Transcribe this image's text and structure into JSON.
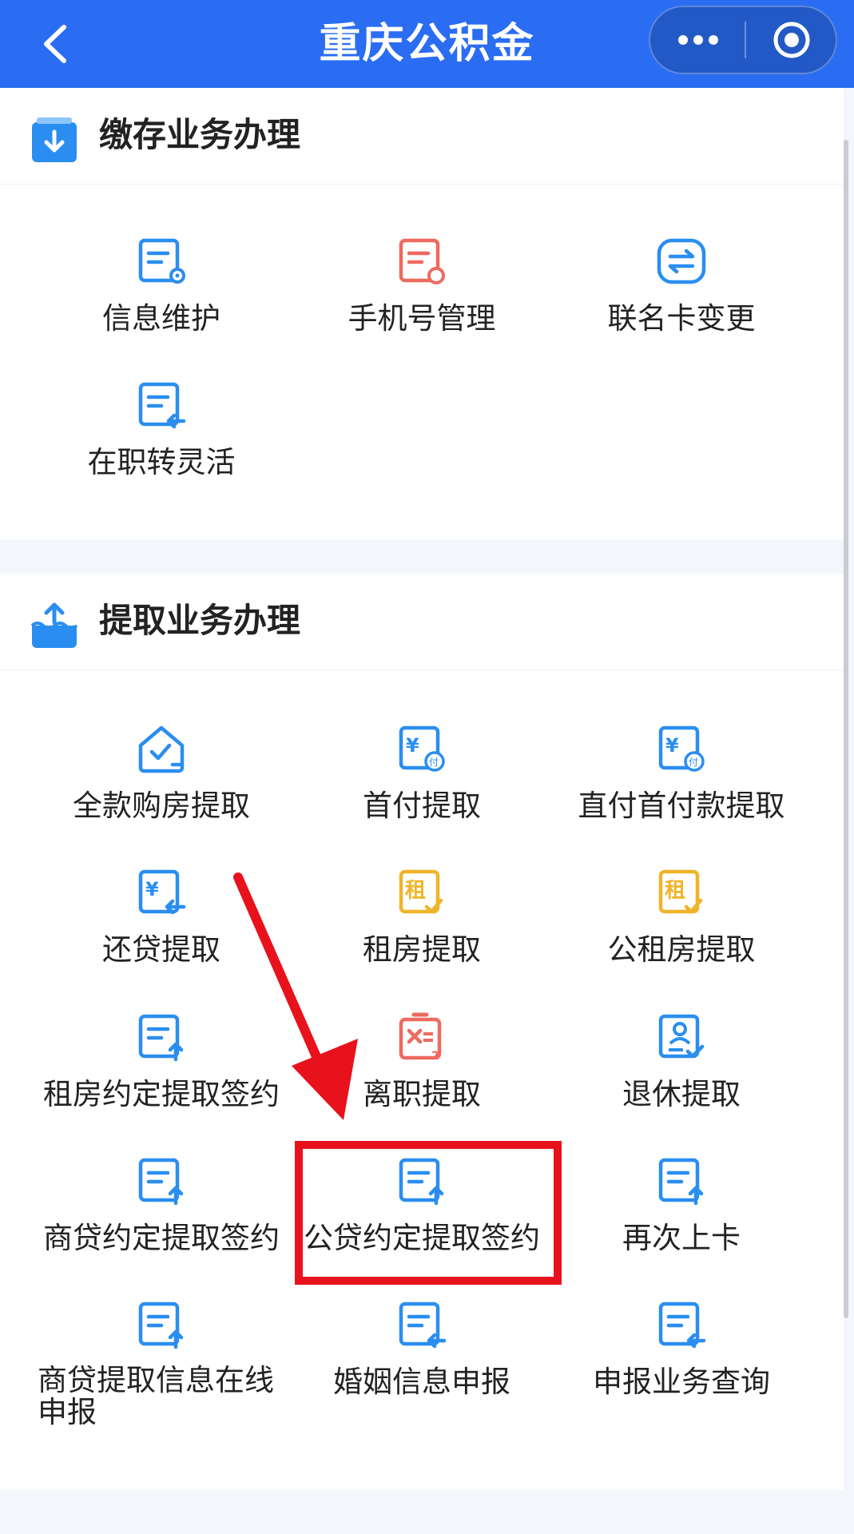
{
  "header": {
    "title": "重庆公积金"
  },
  "section1": {
    "title": "缴存业务办理",
    "items": [
      {
        "label": "信息维护",
        "icon": "form-settings-icon",
        "color": "#2a8ef0"
      },
      {
        "label": "手机号管理",
        "icon": "form-refresh-icon",
        "color": "#ee6a5f"
      },
      {
        "label": "联名卡变更",
        "icon": "card-exchange-icon",
        "color": "#2a8ef0"
      },
      {
        "label": "在职转灵活",
        "icon": "form-return-icon",
        "color": "#2a8ef0"
      }
    ]
  },
  "section2": {
    "title": "提取业务办理",
    "items": [
      {
        "label": "全款购房提取",
        "icon": "house-check-icon",
        "color": "#2a8ef0"
      },
      {
        "label": "首付提取",
        "icon": "yuan-pay-icon",
        "color": "#2a8ef0"
      },
      {
        "label": "直付首付款提取",
        "icon": "yuan-pay-icon",
        "color": "#2a8ef0"
      },
      {
        "label": "还贷提取",
        "icon": "yuan-return-icon",
        "color": "#2a8ef0"
      },
      {
        "label": "租房提取",
        "icon": "rent-icon",
        "color": "#f0b429"
      },
      {
        "label": "公租房提取",
        "icon": "rent-icon",
        "color": "#f0b429"
      },
      {
        "label": "租房约定提取签约",
        "icon": "form-upload-icon",
        "color": "#2a8ef0"
      },
      {
        "label": "离职提取",
        "icon": "resign-icon",
        "color": "#ee6a5f"
      },
      {
        "label": "退休提取",
        "icon": "retire-icon",
        "color": "#2a8ef0"
      },
      {
        "label": "商贷约定提取签约",
        "icon": "form-upload-icon",
        "color": "#2a8ef0"
      },
      {
        "label": "公贷约定提取签约",
        "icon": "form-upload-icon",
        "color": "#2a8ef0"
      },
      {
        "label": "再次上卡",
        "icon": "form-upload-icon",
        "color": "#2a8ef0"
      },
      {
        "label": "商贷提取信息在线申报",
        "icon": "form-upload-icon",
        "color": "#2a8ef0"
      },
      {
        "label": "婚姻信息申报",
        "icon": "form-return-icon",
        "color": "#2a8ef0"
      },
      {
        "label": "申报业务查询",
        "icon": "form-return-icon",
        "color": "#2a8ef0"
      }
    ]
  },
  "annotation": {
    "highlight_color": "#e8121d"
  }
}
